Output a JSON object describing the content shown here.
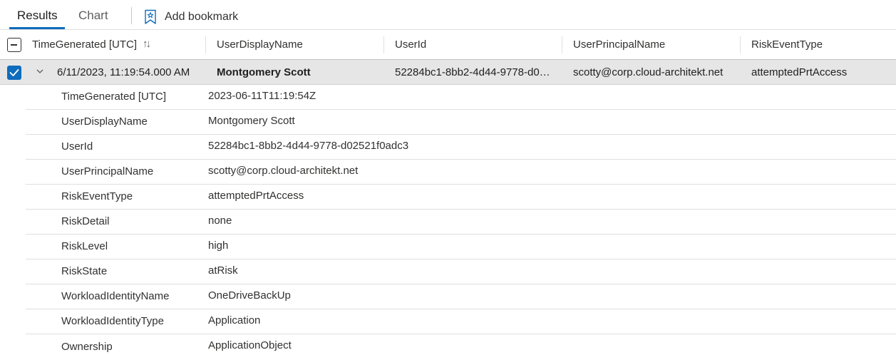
{
  "tabs": {
    "results": "Results",
    "chart": "Chart"
  },
  "toolbar": {
    "add_bookmark": "Add bookmark"
  },
  "columns": [
    "TimeGenerated [UTC]",
    "UserDisplayName",
    "UserId",
    "UserPrincipalName",
    "RiskEventType"
  ],
  "selected_row": {
    "time": "6/11/2023, 11:19:54.000 AM",
    "user_display_name": "Montgomery Scott",
    "user_id": "52284bc1-8bb2-4d44-9778-d0…",
    "user_principal_name": "scotty@corp.cloud-architekt.net",
    "risk_event_type": "attemptedPrtAccess"
  },
  "details": [
    {
      "key": "TimeGenerated [UTC]",
      "value": "2023-06-11T11:19:54Z"
    },
    {
      "key": "UserDisplayName",
      "value": "Montgomery Scott"
    },
    {
      "key": "UserId",
      "value": "52284bc1-8bb2-4d44-9778-d02521f0adc3"
    },
    {
      "key": "UserPrincipalName",
      "value": "scotty@corp.cloud-architekt.net"
    },
    {
      "key": "RiskEventType",
      "value": "attemptedPrtAccess"
    },
    {
      "key": "RiskDetail",
      "value": "none"
    },
    {
      "key": "RiskLevel",
      "value": "high"
    },
    {
      "key": "RiskState",
      "value": "atRisk"
    },
    {
      "key": "WorkloadIdentityName",
      "value": "OneDriveBackUp"
    },
    {
      "key": "WorkloadIdentityType",
      "value": "Application"
    },
    {
      "key": "Ownership",
      "value": "ApplicationObject"
    }
  ],
  "icons": {
    "bookmark": "bookmark-add-icon",
    "sort": "sort-icon",
    "checkbox_partial": "select-all-checkbox",
    "checkbox_checked": "checkmark-icon",
    "expand": "chevron-down-icon"
  },
  "colors": {
    "accent": "#0f6cbd",
    "selected_row_bg": "#e6e6e6"
  }
}
